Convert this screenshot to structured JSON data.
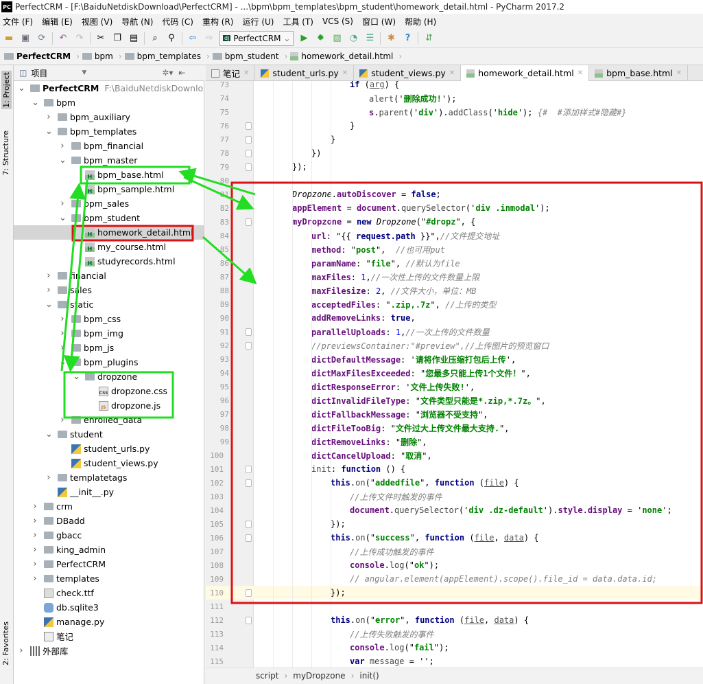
{
  "window": {
    "title": "PerfectCRM - [F:\\BaiduNetdiskDownload\\PerfectCRM] - ...\\bpm\\bpm_templates\\bpm_student\\homework_detail.html - PyCharm 2017.2",
    "logo": "PC"
  },
  "menu": [
    "文件 (F)",
    "编辑 (E)",
    "视图 (V)",
    "导航 (N)",
    "代码 (C)",
    "重构 (R)",
    "运行 (U)",
    "工具 (T)",
    "VCS (S)",
    "窗口 (W)",
    "帮助 (H)"
  ],
  "toolbar": {
    "run_config": "PerfectCRM",
    "icons": [
      "open-icon",
      "save-icon",
      "sync-icon",
      "undo-icon",
      "redo-icon",
      "cut-icon",
      "copy-icon",
      "paste-icon",
      "find-icon",
      "replace-icon",
      "back-icon",
      "forward-icon",
      "run-icon",
      "debug-icon",
      "coverage-icon",
      "profile-icon",
      "concurrency-icon",
      "settings-icon",
      "help-icon",
      "vcs-icon"
    ]
  },
  "navbar": [
    "PerfectCRM",
    "bpm",
    "bpm_templates",
    "bpm_student",
    "homework_detail.html"
  ],
  "left_strip": {
    "project": "1: Project",
    "structure": "7: Structure",
    "favorites": "2: Favorites"
  },
  "project_panel": {
    "title": "项目"
  },
  "tree": [
    {
      "label": "PerfectCRM",
      "sub": "F:\\BaiduNetdiskDownload\\",
      "level": 0,
      "icon": "folder",
      "state": "open",
      "bold": true
    },
    {
      "label": "bpm",
      "level": 1,
      "icon": "folder",
      "state": "open"
    },
    {
      "label": "bpm_auxiliary",
      "level": 2,
      "icon": "folder",
      "state": "closed"
    },
    {
      "label": "bpm_templates",
      "level": 2,
      "icon": "folder",
      "state": "open"
    },
    {
      "label": "bpm_financial",
      "level": 3,
      "icon": "folder",
      "state": "closed"
    },
    {
      "label": "bpm_master",
      "level": 3,
      "icon": "folder",
      "state": "open"
    },
    {
      "label": "bpm_base.html",
      "level": 4,
      "icon": "html"
    },
    {
      "label": "bpm_sample.html",
      "level": 4,
      "icon": "html"
    },
    {
      "label": "bpm_sales",
      "level": 3,
      "icon": "folder",
      "state": "closed"
    },
    {
      "label": "bpm_student",
      "level": 3,
      "icon": "folder",
      "state": "open"
    },
    {
      "label": "homework_detail.html",
      "level": 4,
      "icon": "html",
      "selected": true
    },
    {
      "label": "my_course.html",
      "level": 4,
      "icon": "html"
    },
    {
      "label": "studyrecords.html",
      "level": 4,
      "icon": "html"
    },
    {
      "label": "financial",
      "level": 2,
      "icon": "folder",
      "state": "closed"
    },
    {
      "label": "sales",
      "level": 2,
      "icon": "folder",
      "state": "closed"
    },
    {
      "label": "static",
      "level": 2,
      "icon": "folder",
      "state": "open"
    },
    {
      "label": "bpm_css",
      "level": 3,
      "icon": "folder",
      "state": "closed"
    },
    {
      "label": "bpm_img",
      "level": 3,
      "icon": "folder",
      "state": "closed"
    },
    {
      "label": "bpm_js",
      "level": 3,
      "icon": "folder",
      "state": "closed"
    },
    {
      "label": "bpm_plugins",
      "level": 3,
      "icon": "folder",
      "state": "open"
    },
    {
      "label": "dropzone",
      "level": 4,
      "icon": "folder",
      "state": "open"
    },
    {
      "label": "dropzone.css",
      "level": 5,
      "icon": "css"
    },
    {
      "label": "dropzone.js",
      "level": 5,
      "icon": "js"
    },
    {
      "label": "enrolled_data",
      "level": 3,
      "icon": "folder",
      "state": "closed"
    },
    {
      "label": "student",
      "level": 2,
      "icon": "folder",
      "state": "open"
    },
    {
      "label": "student_urls.py",
      "level": 3,
      "icon": "py"
    },
    {
      "label": "student_views.py",
      "level": 3,
      "icon": "py"
    },
    {
      "label": "templatetags",
      "level": 2,
      "icon": "folder",
      "state": "closed"
    },
    {
      "label": "__init__.py",
      "level": 2,
      "icon": "py"
    },
    {
      "label": "crm",
      "level": 1,
      "icon": "folder",
      "state": "closed"
    },
    {
      "label": "DBadd",
      "level": 1,
      "icon": "folder",
      "state": "closed"
    },
    {
      "label": "gbacc",
      "level": 1,
      "icon": "folder",
      "state": "closed"
    },
    {
      "label": "king_admin",
      "level": 1,
      "icon": "folder",
      "state": "closed"
    },
    {
      "label": "PerfectCRM",
      "level": 1,
      "icon": "folder",
      "state": "closed"
    },
    {
      "label": "templates",
      "level": 1,
      "icon": "folder",
      "state": "closed"
    },
    {
      "label": "check.ttf",
      "level": 1,
      "icon": "file"
    },
    {
      "label": "db.sqlite3",
      "level": 1,
      "icon": "db"
    },
    {
      "label": "manage.py",
      "level": 1,
      "icon": "py"
    },
    {
      "label": "笔记",
      "level": 1,
      "icon": "note"
    },
    {
      "label": "外部库",
      "level": 0,
      "icon": "lib",
      "state": "closed"
    }
  ],
  "tabs": [
    {
      "label": "笔记",
      "icon": "note"
    },
    {
      "label": "student_urls.py",
      "icon": "py"
    },
    {
      "label": "student_views.py",
      "icon": "py"
    },
    {
      "label": "homework_detail.html",
      "icon": "html",
      "active": true
    },
    {
      "label": "bpm_base.html",
      "icon": "html"
    }
  ],
  "code": [
    {
      "n": "73",
      "ind": 5,
      "t": [
        [
          "k",
          "if"
        ],
        [
          "v",
          " ("
        ],
        [
          "u",
          "arg"
        ],
        [
          "v",
          ") {"
        ]
      ]
    },
    {
      "n": "74",
      "ind": 6,
      "t": [
        [
          "f",
          "alert"
        ],
        [
          "v",
          "('"
        ],
        [
          "s",
          "删除成功!"
        ],
        [
          "v",
          "');"
        ]
      ]
    },
    {
      "n": "75",
      "ind": 6,
      "t": [
        [
          "p",
          "s"
        ],
        [
          "v",
          "."
        ],
        [
          "f",
          "parent"
        ],
        [
          "v",
          "('"
        ],
        [
          "s",
          "div"
        ],
        [
          "v",
          "')."
        ],
        [
          "f",
          "addClass"
        ],
        [
          "v",
          "('"
        ],
        [
          "s",
          "hide"
        ],
        [
          "v",
          "'); "
        ],
        [
          "c",
          "{#  #添加样式#隐藏#}"
        ]
      ]
    },
    {
      "n": "76",
      "ind": 5,
      "t": [
        [
          "v",
          "}"
        ]
      ]
    },
    {
      "n": "77",
      "ind": 4,
      "t": [
        [
          "v",
          "}"
        ]
      ]
    },
    {
      "n": "78",
      "ind": 3,
      "t": [
        [
          "v",
          "})"
        ]
      ]
    },
    {
      "n": "79",
      "ind": 2,
      "t": [
        [
          "v",
          "});"
        ]
      ]
    },
    {
      "n": "80",
      "ind": 0,
      "t": []
    },
    {
      "n": "81",
      "ind": 2,
      "t": [
        [
          "i",
          "Dropzone"
        ],
        [
          "v",
          "."
        ],
        [
          "p",
          "autoDiscover"
        ],
        [
          "v",
          " = "
        ],
        [
          "k",
          "false"
        ],
        [
          "v",
          ";"
        ]
      ]
    },
    {
      "n": "82",
      "ind": 2,
      "t": [
        [
          "p",
          "appElement"
        ],
        [
          "v",
          " = "
        ],
        [
          "p",
          "document"
        ],
        [
          "v",
          "."
        ],
        [
          "f",
          "querySelector"
        ],
        [
          "v",
          "('"
        ],
        [
          "s",
          "div .inmodal"
        ],
        [
          "v",
          "');"
        ]
      ]
    },
    {
      "n": "83",
      "ind": 2,
      "t": [
        [
          "p",
          "myDropzone"
        ],
        [
          "v",
          " = "
        ],
        [
          "k",
          "new "
        ],
        [
          "i",
          "Dropzone"
        ],
        [
          "v",
          "(\""
        ],
        [
          "s",
          "#dropz"
        ],
        [
          "v",
          "\", {"
        ]
      ]
    },
    {
      "n": "84",
      "ind": 3,
      "t": [
        [
          "p",
          "url"
        ],
        [
          "v",
          ": \"{{ "
        ],
        [
          "k",
          "request.path"
        ],
        [
          "v",
          " }}\","
        ],
        [
          "c",
          "//文件提交地址"
        ]
      ]
    },
    {
      "n": "85",
      "ind": 3,
      "t": [
        [
          "p",
          "method"
        ],
        [
          "v",
          ": \""
        ],
        [
          "s",
          "post"
        ],
        [
          "v",
          "\",  "
        ],
        [
          "c",
          "//也可用put"
        ]
      ]
    },
    {
      "n": "86",
      "ind": 3,
      "t": [
        [
          "p",
          "paramName"
        ],
        [
          "v",
          ": \""
        ],
        [
          "s",
          "file"
        ],
        [
          "v",
          "\", "
        ],
        [
          "c",
          "//默认为file"
        ]
      ]
    },
    {
      "n": "87",
      "ind": 3,
      "t": [
        [
          "p",
          "maxFiles"
        ],
        [
          "v",
          ": "
        ],
        [
          "n",
          "1"
        ],
        [
          "v",
          ","
        ],
        [
          "c",
          "//一次性上传的文件数量上限"
        ]
      ]
    },
    {
      "n": "88",
      "ind": 3,
      "t": [
        [
          "p",
          "maxFilesize"
        ],
        [
          "v",
          ": "
        ],
        [
          "n",
          "2"
        ],
        [
          "v",
          ", "
        ],
        [
          "c",
          "//文件大小，单位：MB"
        ]
      ]
    },
    {
      "n": "89",
      "ind": 3,
      "t": [
        [
          "p",
          "acceptedFiles"
        ],
        [
          "v",
          ": \""
        ],
        [
          "s",
          ".zip,.7z"
        ],
        [
          "v",
          "\", "
        ],
        [
          "c",
          "//上传的类型"
        ]
      ]
    },
    {
      "n": "90",
      "ind": 3,
      "t": [
        [
          "p",
          "addRemoveLinks"
        ],
        [
          "v",
          ": "
        ],
        [
          "k",
          "true"
        ],
        [
          "v",
          ","
        ]
      ]
    },
    {
      "n": "91",
      "ind": 3,
      "t": [
        [
          "p",
          "parallelUploads"
        ],
        [
          "v",
          ": "
        ],
        [
          "n",
          "1"
        ],
        [
          "v",
          ","
        ],
        [
          "c",
          "//一次上传的文件数量"
        ]
      ]
    },
    {
      "n": "92",
      "ind": 3,
      "t": [
        [
          "c",
          "//previewsContainer:\"#preview\",//上传图片的预览窗口"
        ]
      ]
    },
    {
      "n": "93",
      "ind": 3,
      "t": [
        [
          "p",
          "dictDefaultMessage"
        ],
        [
          "v",
          ": '"
        ],
        [
          "s",
          "请将作业压缩打包后上传"
        ],
        [
          "v",
          "',"
        ]
      ]
    },
    {
      "n": "94",
      "ind": 3,
      "t": [
        [
          "p",
          "dictMaxFilesExceeded"
        ],
        [
          "v",
          ": \""
        ],
        [
          "s",
          "您最多只能上传1个文件！"
        ],
        [
          "v",
          "\","
        ]
      ]
    },
    {
      "n": "95",
      "ind": 3,
      "t": [
        [
          "p",
          "dictResponseError"
        ],
        [
          "v",
          ": '"
        ],
        [
          "s",
          "文件上传失败!"
        ],
        [
          "v",
          "',"
        ]
      ]
    },
    {
      "n": "96",
      "ind": 3,
      "t": [
        [
          "p",
          "dictInvalidFileType"
        ],
        [
          "v",
          ": \""
        ],
        [
          "s",
          "文件类型只能是*.zip,*.7z。"
        ],
        [
          "v",
          "\","
        ]
      ]
    },
    {
      "n": "97",
      "ind": 3,
      "t": [
        [
          "p",
          "dictFallbackMessage"
        ],
        [
          "v",
          ": \""
        ],
        [
          "s",
          "浏览器不受支持"
        ],
        [
          "v",
          "\","
        ]
      ]
    },
    {
      "n": "98",
      "ind": 3,
      "t": [
        [
          "p",
          "dictFileTooBig"
        ],
        [
          "v",
          ": \""
        ],
        [
          "s",
          "文件过大上传文件最大支持."
        ],
        [
          "v",
          "\","
        ]
      ]
    },
    {
      "n": "99",
      "ind": 3,
      "t": [
        [
          "p",
          "dictRemoveLinks"
        ],
        [
          "v",
          ": \""
        ],
        [
          "s",
          "删除"
        ],
        [
          "v",
          "\","
        ]
      ]
    },
    {
      "n": "100",
      "ind": 3,
      "t": [
        [
          "p",
          "dictCancelUpload"
        ],
        [
          "v",
          ": \""
        ],
        [
          "s",
          "取消"
        ],
        [
          "v",
          "\","
        ]
      ]
    },
    {
      "n": "101",
      "ind": 3,
      "t": [
        [
          "f",
          "init"
        ],
        [
          "v",
          ": "
        ],
        [
          "k",
          "function"
        ],
        [
          "v",
          " () {"
        ]
      ]
    },
    {
      "n": "102",
      "ind": 4,
      "t": [
        [
          "k",
          "this"
        ],
        [
          "v",
          "."
        ],
        [
          "f",
          "on"
        ],
        [
          "v",
          "(\""
        ],
        [
          "s",
          "addedfile"
        ],
        [
          "v",
          "\", "
        ],
        [
          "k",
          "function"
        ],
        [
          "v",
          " ("
        ],
        [
          "u",
          "file"
        ],
        [
          "v",
          ") {"
        ]
      ]
    },
    {
      "n": "103",
      "ind": 5,
      "t": [
        [
          "c",
          "//上传文件时触发的事件"
        ]
      ]
    },
    {
      "n": "104",
      "ind": 5,
      "t": [
        [
          "p",
          "document"
        ],
        [
          "v",
          "."
        ],
        [
          "f",
          "querySelector"
        ],
        [
          "v",
          "('"
        ],
        [
          "s",
          "div .dz-default"
        ],
        [
          "v",
          "')."
        ],
        [
          "p",
          "style"
        ],
        [
          "v",
          "."
        ],
        [
          "p",
          "display"
        ],
        [
          "v",
          " = '"
        ],
        [
          "s",
          "none"
        ],
        [
          "v",
          "';"
        ]
      ]
    },
    {
      "n": "105",
      "ind": 4,
      "t": [
        [
          "v",
          "});"
        ]
      ]
    },
    {
      "n": "106",
      "ind": 4,
      "t": [
        [
          "k",
          "this"
        ],
        [
          "v",
          "."
        ],
        [
          "f",
          "on"
        ],
        [
          "v",
          "(\""
        ],
        [
          "s",
          "success"
        ],
        [
          "v",
          "\", "
        ],
        [
          "k",
          "function"
        ],
        [
          "v",
          " ("
        ],
        [
          "u",
          "file"
        ],
        [
          "v",
          ", "
        ],
        [
          "u",
          "data"
        ],
        [
          "v",
          ") {"
        ]
      ]
    },
    {
      "n": "107",
      "ind": 5,
      "t": [
        [
          "c",
          "//上传成功触发的事件"
        ]
      ]
    },
    {
      "n": "108",
      "ind": 5,
      "t": [
        [
          "p",
          "console"
        ],
        [
          "v",
          "."
        ],
        [
          "f",
          "log"
        ],
        [
          "v",
          "(\""
        ],
        [
          "s",
          "ok"
        ],
        [
          "v",
          "\");"
        ]
      ]
    },
    {
      "n": "109",
      "ind": 5,
      "t": [
        [
          "c",
          "// angular.element(appElement).scope().file_id = data.data.id;"
        ]
      ]
    },
    {
      "n": "110",
      "ind": 4,
      "t": [
        [
          "v",
          "});"
        ]
      ],
      "current": true
    },
    {
      "n": "111",
      "ind": 0,
      "t": []
    },
    {
      "n": "112",
      "ind": 4,
      "t": [
        [
          "k",
          "this"
        ],
        [
          "v",
          "."
        ],
        [
          "f",
          "on"
        ],
        [
          "v",
          "(\""
        ],
        [
          "s",
          "error"
        ],
        [
          "v",
          "\", "
        ],
        [
          "k",
          "function"
        ],
        [
          "v",
          " ("
        ],
        [
          "u",
          "file"
        ],
        [
          "v",
          ", "
        ],
        [
          "u",
          "data"
        ],
        [
          "v",
          ") {"
        ]
      ]
    },
    {
      "n": "113",
      "ind": 5,
      "t": [
        [
          "c",
          "//上传失败触发的事件"
        ]
      ]
    },
    {
      "n": "114",
      "ind": 5,
      "t": [
        [
          "p",
          "console"
        ],
        [
          "v",
          "."
        ],
        [
          "f",
          "log"
        ],
        [
          "v",
          "(\""
        ],
        [
          "s",
          "fail"
        ],
        [
          "v",
          "\");"
        ]
      ]
    },
    {
      "n": "115",
      "ind": 5,
      "t": [
        [
          "k",
          "var "
        ],
        [
          "f",
          "message"
        ],
        [
          "v",
          " = '';"
        ]
      ]
    }
  ],
  "editor_breadcrumb": [
    "script",
    "myDropzone",
    "init()"
  ],
  "annotation_colors": {
    "green": "#22dd22",
    "red": "#dd1111"
  }
}
